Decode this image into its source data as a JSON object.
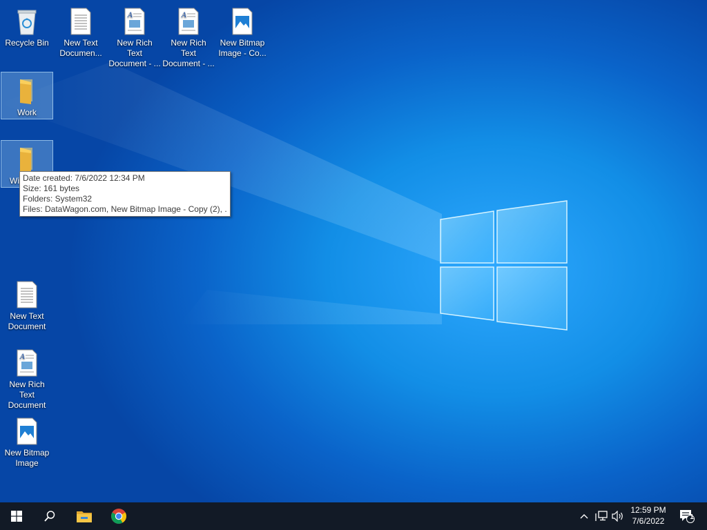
{
  "desktop": {
    "icons": [
      {
        "label": "Recycle Bin"
      },
      {
        "label": "New Text Documen..."
      },
      {
        "label": "New Rich Text Document - ..."
      },
      {
        "label": "New Rich Text Document - ..."
      },
      {
        "label": "New Bitmap Image - Co..."
      },
      {
        "label": "Work"
      },
      {
        "label": "Wi"
      },
      {
        "label": "New Text Document"
      },
      {
        "label": "New Rich Text Document"
      },
      {
        "label": "New Bitmap Image"
      }
    ]
  },
  "tooltip": {
    "date_created": "Date created: 7/6/2022 12:34 PM",
    "size": "Size: 161 bytes",
    "folders": "Folders: System32",
    "files": "Files: DataWagon.com, New Bitmap Image - Copy (2), ..."
  },
  "taskbar": {
    "time": "12:59 PM",
    "date": "7/6/2022",
    "notification_count": "1"
  },
  "colors": {
    "taskbar": "#121a26",
    "folder": "#f3c34c",
    "accent": "#0a63c9"
  }
}
